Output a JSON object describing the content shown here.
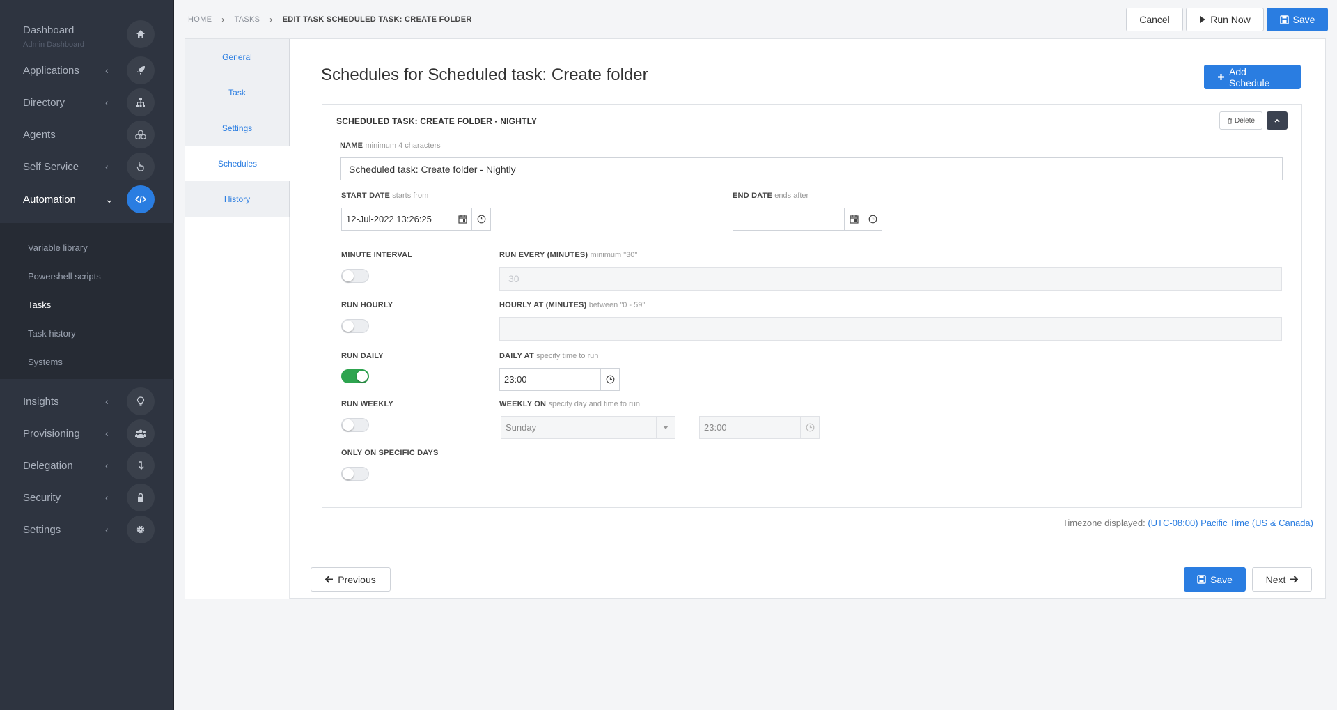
{
  "sidebar": {
    "items": [
      {
        "label": "Dashboard",
        "sub": "Admin Dashboard",
        "icon": "home-icon"
      },
      {
        "label": "Applications",
        "icon": "rocket-icon"
      },
      {
        "label": "Directory",
        "icon": "sitemap-icon"
      },
      {
        "label": "Agents",
        "icon": "cubes-icon"
      },
      {
        "label": "Self Service",
        "icon": "hand-pointer-icon"
      },
      {
        "label": "Automation",
        "icon": "code-icon"
      },
      {
        "label": "Insights",
        "icon": "lightbulb-icon"
      },
      {
        "label": "Provisioning",
        "icon": "users-icon"
      },
      {
        "label": "Delegation",
        "icon": "level-down-icon"
      },
      {
        "label": "Security",
        "icon": "lock-icon"
      },
      {
        "label": "Settings",
        "icon": "gear-icon"
      }
    ],
    "automation_sub": [
      "Variable library",
      "Powershell scripts",
      "Tasks",
      "Task history",
      "Systems"
    ]
  },
  "breadcrumb": [
    "HOME",
    "TASKS",
    "EDIT TASK SCHEDULED TASK: CREATE FOLDER"
  ],
  "top_actions": {
    "cancel": "Cancel",
    "run_now": "Run Now",
    "save": "Save"
  },
  "tabs": [
    "General",
    "Task",
    "Settings",
    "Schedules",
    "History"
  ],
  "page_title": "Schedules for Scheduled task: Create folder",
  "add_schedule": "Add Schedule",
  "schedule": {
    "title": "SCHEDULED TASK: CREATE FOLDER - NIGHTLY",
    "delete": "Delete",
    "name_label": "NAME",
    "name_hint": "minimum 4 characters",
    "name_value": "Scheduled task: Create folder - Nightly",
    "start_label": "START DATE",
    "start_hint": "starts from",
    "start_value": "12-Jul-2022 13:26:25",
    "end_label": "END DATE",
    "end_hint": "ends after",
    "end_value": "",
    "minute_interval": "MINUTE INTERVAL",
    "run_every_label": "RUN EVERY (MINUTES)",
    "run_every_hint": "minimum \"30\"",
    "run_every_value": "30",
    "run_hourly": "RUN HOURLY",
    "hourly_at_label": "HOURLY AT (MINUTES)",
    "hourly_at_hint": "between \"0 - 59\"",
    "hourly_at_value": "",
    "run_daily": "RUN DAILY",
    "daily_at_label": "DAILY AT",
    "daily_at_hint": "specify time to run",
    "daily_at_value": "23:00",
    "run_weekly": "RUN WEEKLY",
    "weekly_on_label": "WEEKLY ON",
    "weekly_on_hint": "specify day and time to run",
    "weekly_day": "Sunday",
    "weekly_time": "23:00",
    "specific_days": "ONLY ON SPECIFIC DAYS",
    "toggles": {
      "minute_interval": false,
      "run_hourly": false,
      "run_daily": true,
      "run_weekly": false,
      "specific_days": false
    }
  },
  "timezone_prefix": "Timezone displayed:",
  "timezone_value": "(UTC-08:00) Pacific Time (US & Canada)",
  "footer": {
    "previous": "Previous",
    "save": "Save",
    "next": "Next"
  },
  "colors": {
    "primary": "#2a7de1",
    "sidebar_bg": "#2e3440",
    "toggle_on": "#2ea44f"
  }
}
